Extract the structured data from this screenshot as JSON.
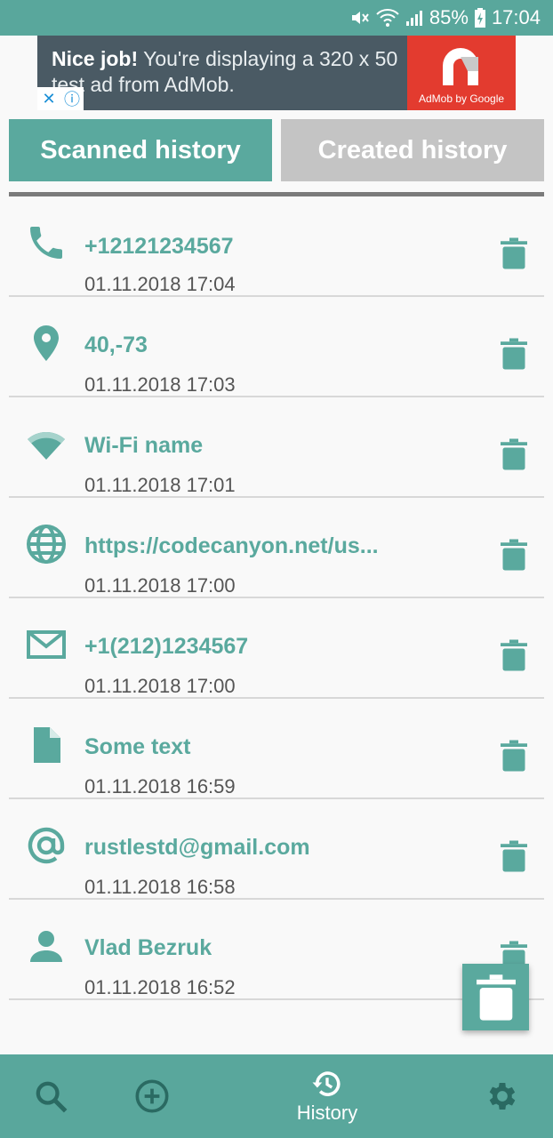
{
  "status_bar": {
    "battery": "85%",
    "time": "17:04"
  },
  "ad": {
    "headline": "Nice job!",
    "message": " You're displaying a 320 x 50 test ad from AdMob.",
    "brand": "AdMob by Google"
  },
  "tabs": {
    "scanned": "Scanned history",
    "created": "Created history"
  },
  "history": [
    {
      "icon": "phone-icon",
      "title": "+12121234567",
      "date": "01.11.2018 17:04"
    },
    {
      "icon": "location-icon",
      "title": "40,-73",
      "date": "01.11.2018 17:03"
    },
    {
      "icon": "wifi-icon",
      "title": "Wi-Fi name",
      "date": "01.11.2018 17:01"
    },
    {
      "icon": "globe-icon",
      "title": "https://codecanyon.net/us...",
      "date": "01.11.2018 17:00"
    },
    {
      "icon": "email-icon",
      "title": "+1(212)1234567",
      "date": "01.11.2018 17:00"
    },
    {
      "icon": "document-icon",
      "title": "Some text",
      "date": "01.11.2018 16:59"
    },
    {
      "icon": "at-sign-icon",
      "title": "rustlestd@gmail.com",
      "date": "01.11.2018 16:58"
    },
    {
      "icon": "person-icon",
      "title": "Vlad Bezruk",
      "date": "01.11.2018 16:52"
    }
  ],
  "bottom_nav": {
    "history_label": "History"
  },
  "colors": {
    "accent": "#5aa99e",
    "tab_inactive": "#c4c4c4",
    "date_text": "#555555"
  }
}
